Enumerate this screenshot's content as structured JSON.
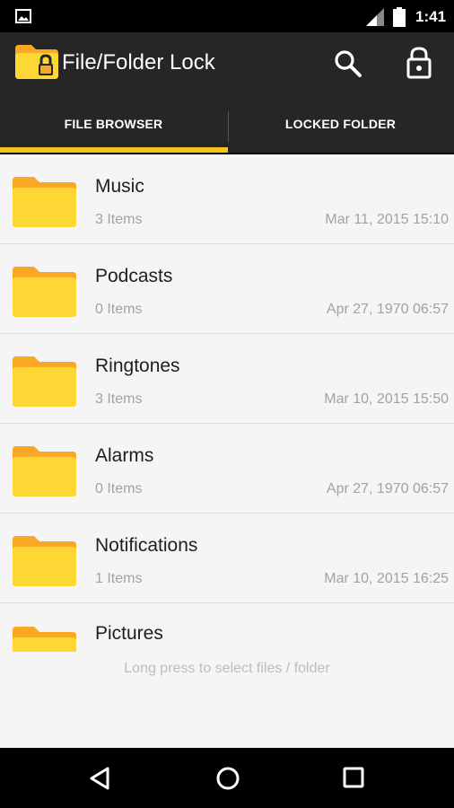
{
  "status_bar": {
    "time": "1:41",
    "icons": [
      "gallery-icon",
      "signal-icon",
      "battery-icon"
    ]
  },
  "app_bar": {
    "title": "File/Folder Lock",
    "icons": [
      "folder-lock-icon",
      "search-icon",
      "lock-icon"
    ]
  },
  "tabs": [
    {
      "label": "FILE BROWSER",
      "active": true
    },
    {
      "label": "LOCKED FOLDER",
      "active": false
    }
  ],
  "folders": [
    {
      "name": "Music",
      "count": "3 Items",
      "date": "Mar 11, 2015 15:10"
    },
    {
      "name": "Podcasts",
      "count": "0 Items",
      "date": "Apr 27, 1970 06:57"
    },
    {
      "name": "Ringtones",
      "count": "3 Items",
      "date": "Mar 10, 2015 15:50"
    },
    {
      "name": "Alarms",
      "count": "0 Items",
      "date": "Apr 27, 1970 06:57"
    },
    {
      "name": "Notifications",
      "count": "1 Items",
      "date": "Mar 10, 2015 16:25"
    },
    {
      "name": "Pictures"
    }
  ],
  "hint": "Long press to select files / folder",
  "colors": {
    "accent": "#f7c21b",
    "toolbar": "#262626",
    "folder_front": "#fdd835",
    "folder_back": "#f9a825"
  },
  "nav_bar": {
    "icons": [
      "back-icon",
      "home-icon",
      "recent-apps-icon"
    ]
  }
}
